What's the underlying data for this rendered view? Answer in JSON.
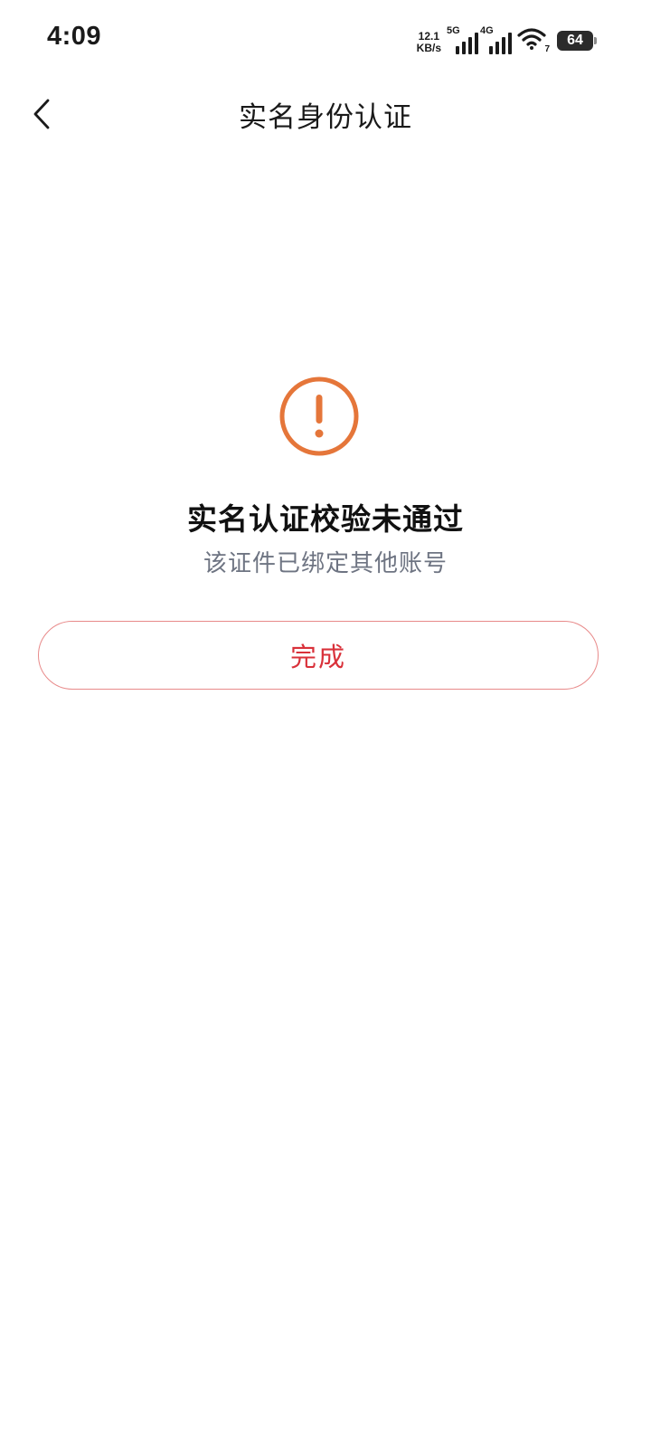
{
  "status_bar": {
    "time": "4:09",
    "net_speed_value": "12.1",
    "net_speed_unit": "KB/s",
    "sim1_label": "5G",
    "sim2_label": "4G",
    "wifi_sub": "7",
    "battery_level": "64"
  },
  "nav": {
    "title": "实名身份认证",
    "back_icon": "chevron-left-icon"
  },
  "result": {
    "icon": "exclamation-circle-icon",
    "icon_color": "#E5763A",
    "title": "实名认证校验未通过",
    "description": "该证件已绑定其他账号"
  },
  "actions": {
    "done_label": "完成",
    "done_color": "#D9313A",
    "done_border_color": "#E88A8A"
  }
}
